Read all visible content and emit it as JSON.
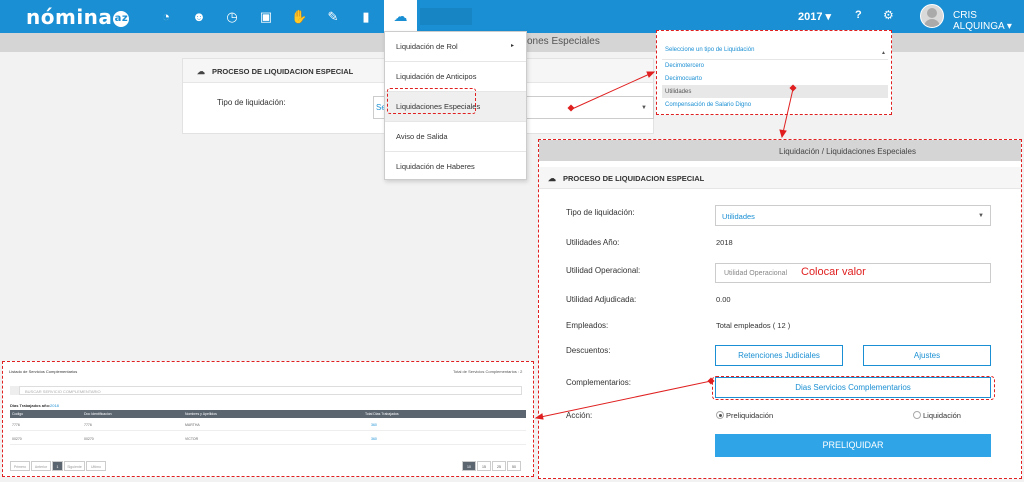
{
  "topbar": {
    "logo": "nómina",
    "logo_badge": "az",
    "nav_icons": [
      "dashboard-icon",
      "users-icon",
      "clock-icon",
      "briefcase-icon",
      "handshake-icon",
      "edit-icon",
      "chart-icon",
      "cloud-upload-icon"
    ],
    "year": "2017 ▾",
    "help": "?",
    "user_name": "CRIS ALQUINGA ▾"
  },
  "subheader": {
    "breadcrumb": "ones Especiales"
  },
  "panel1": {
    "title": "PROCESO DE LIQUIDACION ESPECIAL",
    "field_label": "Tipo de liquidación:",
    "select_value": "Se"
  },
  "dropdown": {
    "items": [
      {
        "label": "Liquidación de Rol"
      },
      {
        "label": "Liquidación de Anticipos"
      },
      {
        "label": "Liquidaciones Especiales"
      },
      {
        "label": "Aviso de Salida"
      },
      {
        "label": "Liquidación de Haberes"
      }
    ]
  },
  "popup": {
    "title": "Seleccione un tipo de Liquidación",
    "options": [
      "Decimotercero",
      "Decimocuarto",
      "Utilidades",
      "Compensación de Salario Digno"
    ]
  },
  "main": {
    "header": "Liquidación / Liquidaciones Especiales",
    "title": "PROCESO DE LIQUIDACION ESPECIAL",
    "labels": {
      "tipo": "Tipo de liquidación:",
      "anio": "Utilidades Año:",
      "operacional": "Utilidad Operacional:",
      "adjudicada": "Utilidad Adjudicada:",
      "empleados": "Empleados:",
      "descuentos": "Descuentos:",
      "complementarios": "Complementarios:",
      "accion": "Acción:"
    },
    "values": {
      "tipo": "Utilidades",
      "anio": "2018",
      "operacional_placeholder": "Utilidad Operacional",
      "adjudicada": "0.00",
      "empleados": "Total empleados ( 12 )"
    },
    "hint": "Colocar valor",
    "buttons": {
      "retenciones": "Retenciones Judiciales",
      "ajustes": "Ajustes",
      "dias": "Dias Servicios Complementarios",
      "preliquidar": "PRELIQUIDAR"
    },
    "radios": {
      "pre": "Preliquidación",
      "liq": "Liquidación"
    }
  },
  "mini": {
    "title": "Listado de Servicios Complementarios",
    "total": "Total de Servicios Complementarios : 2",
    "search_placeholder": "BUSCAR SERVICIO COMPLEMENTARIO",
    "year_label": "Dias Trabajados año:",
    "year_value": "2018",
    "columns": [
      "Codigo",
      "Doc Identificacion",
      "Nombres y Apellidos",
      "Total Dias Trabajados"
    ],
    "rows": [
      [
        "7776",
        "7776",
        "MARTHA",
        "360"
      ],
      [
        "00270",
        "00270",
        "VICTOR",
        "360"
      ]
    ],
    "pager": [
      "Primero",
      "Anterior",
      "1",
      "Siguiente",
      "Ultimo"
    ],
    "page_sizes": [
      "10",
      "15",
      "25",
      "50"
    ]
  }
}
